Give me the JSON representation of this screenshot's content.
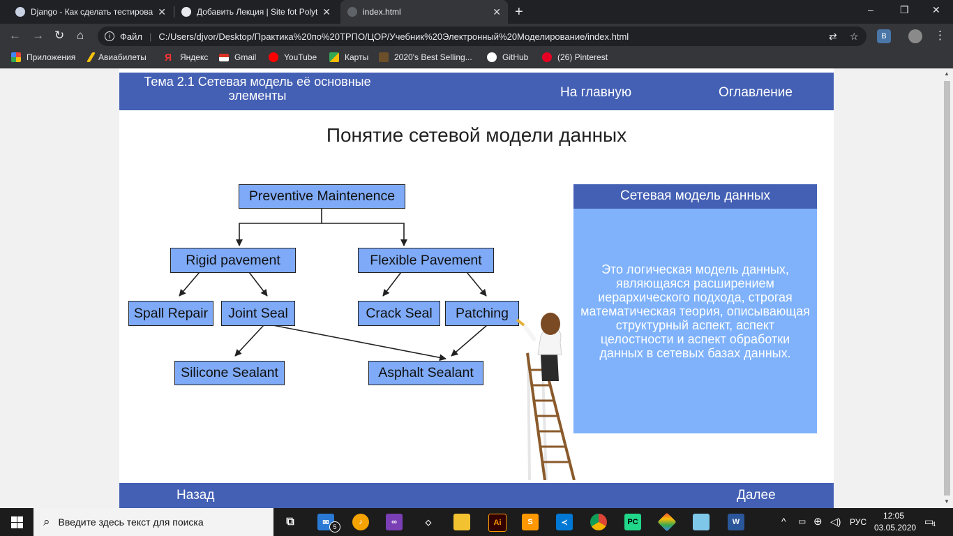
{
  "browser": {
    "tabs": [
      {
        "title": "Django - Как сделать тестировани",
        "active": false
      },
      {
        "title": "Добавить Лекция | Site fot Polytech",
        "active": false
      },
      {
        "title": "index.html",
        "active": true
      }
    ],
    "new_tab": "+",
    "window_controls": {
      "minimize": "–",
      "restore": "❐",
      "close": "✕"
    },
    "address": {
      "label": "Файл",
      "url": "C:/Users/djvor/Desktop/Практика%20по%20ТРПО/ЦОР/Учебник%20Электронный%20Моделирование/index.html"
    },
    "bookmarks": [
      {
        "label": "Приложения",
        "icon": "apps-grid-icon",
        "color": "#e8453c"
      },
      {
        "label": "Авиабилеты",
        "icon": "plane-icon",
        "color": "#f4c20d"
      },
      {
        "label": "Яндекс",
        "icon": "yandex-icon",
        "color": "#ff0000"
      },
      {
        "label": "Gmail",
        "icon": "gmail-icon",
        "color": "#d93025"
      },
      {
        "label": "YouTube",
        "icon": "youtube-icon",
        "color": "#ff0000"
      },
      {
        "label": "Карты",
        "icon": "maps-icon",
        "color": "#34a853"
      },
      {
        "label": "2020's Best Selling...",
        "icon": "book-icon",
        "color": "#8a6d3b"
      },
      {
        "label": "GitHub",
        "icon": "github-icon",
        "color": "#ffffff"
      },
      {
        "label": "(26) Pinterest",
        "icon": "pinterest-icon",
        "color": "#e60023"
      }
    ],
    "extension_badge": "B"
  },
  "site": {
    "header": {
      "topic": "Тема 2.1 Сетевая модель её основные элементы",
      "home_link": "На главную",
      "contents_link": "Оглавление"
    },
    "page_title": "Понятие сетевой модели данных",
    "diagram": {
      "nodes": [
        {
          "id": "preventive",
          "label": "Preventive Maintenence"
        },
        {
          "id": "rigid",
          "label": "Rigid pavement"
        },
        {
          "id": "flexible",
          "label": "Flexible Pavement"
        },
        {
          "id": "spall",
          "label": "Spall Repair"
        },
        {
          "id": "joint",
          "label": "Joint Seal"
        },
        {
          "id": "crack",
          "label": "Crack Seal"
        },
        {
          "id": "patching",
          "label": "Patching"
        },
        {
          "id": "silicone",
          "label": "Silicone Sealant"
        },
        {
          "id": "asphalt",
          "label": "Asphalt Sealant"
        }
      ]
    },
    "info_box": {
      "title": "Сетевая модель данных",
      "text": "Это логическая модель данных, являющаяся расширением иерархического подхода, строгая математическая теория, описывающая структурный аспект, аспект целостности и аспект обработки данных в сетевых базах данных."
    },
    "footer": {
      "back": "Назад",
      "next": "Далее"
    }
  },
  "taskbar": {
    "search_placeholder": "Введите здесь текст для поиска",
    "mail_badge": "5",
    "tray": {
      "language": "РУС",
      "time": "12:05",
      "date": "03.05.2020",
      "notifications": "4"
    }
  }
}
